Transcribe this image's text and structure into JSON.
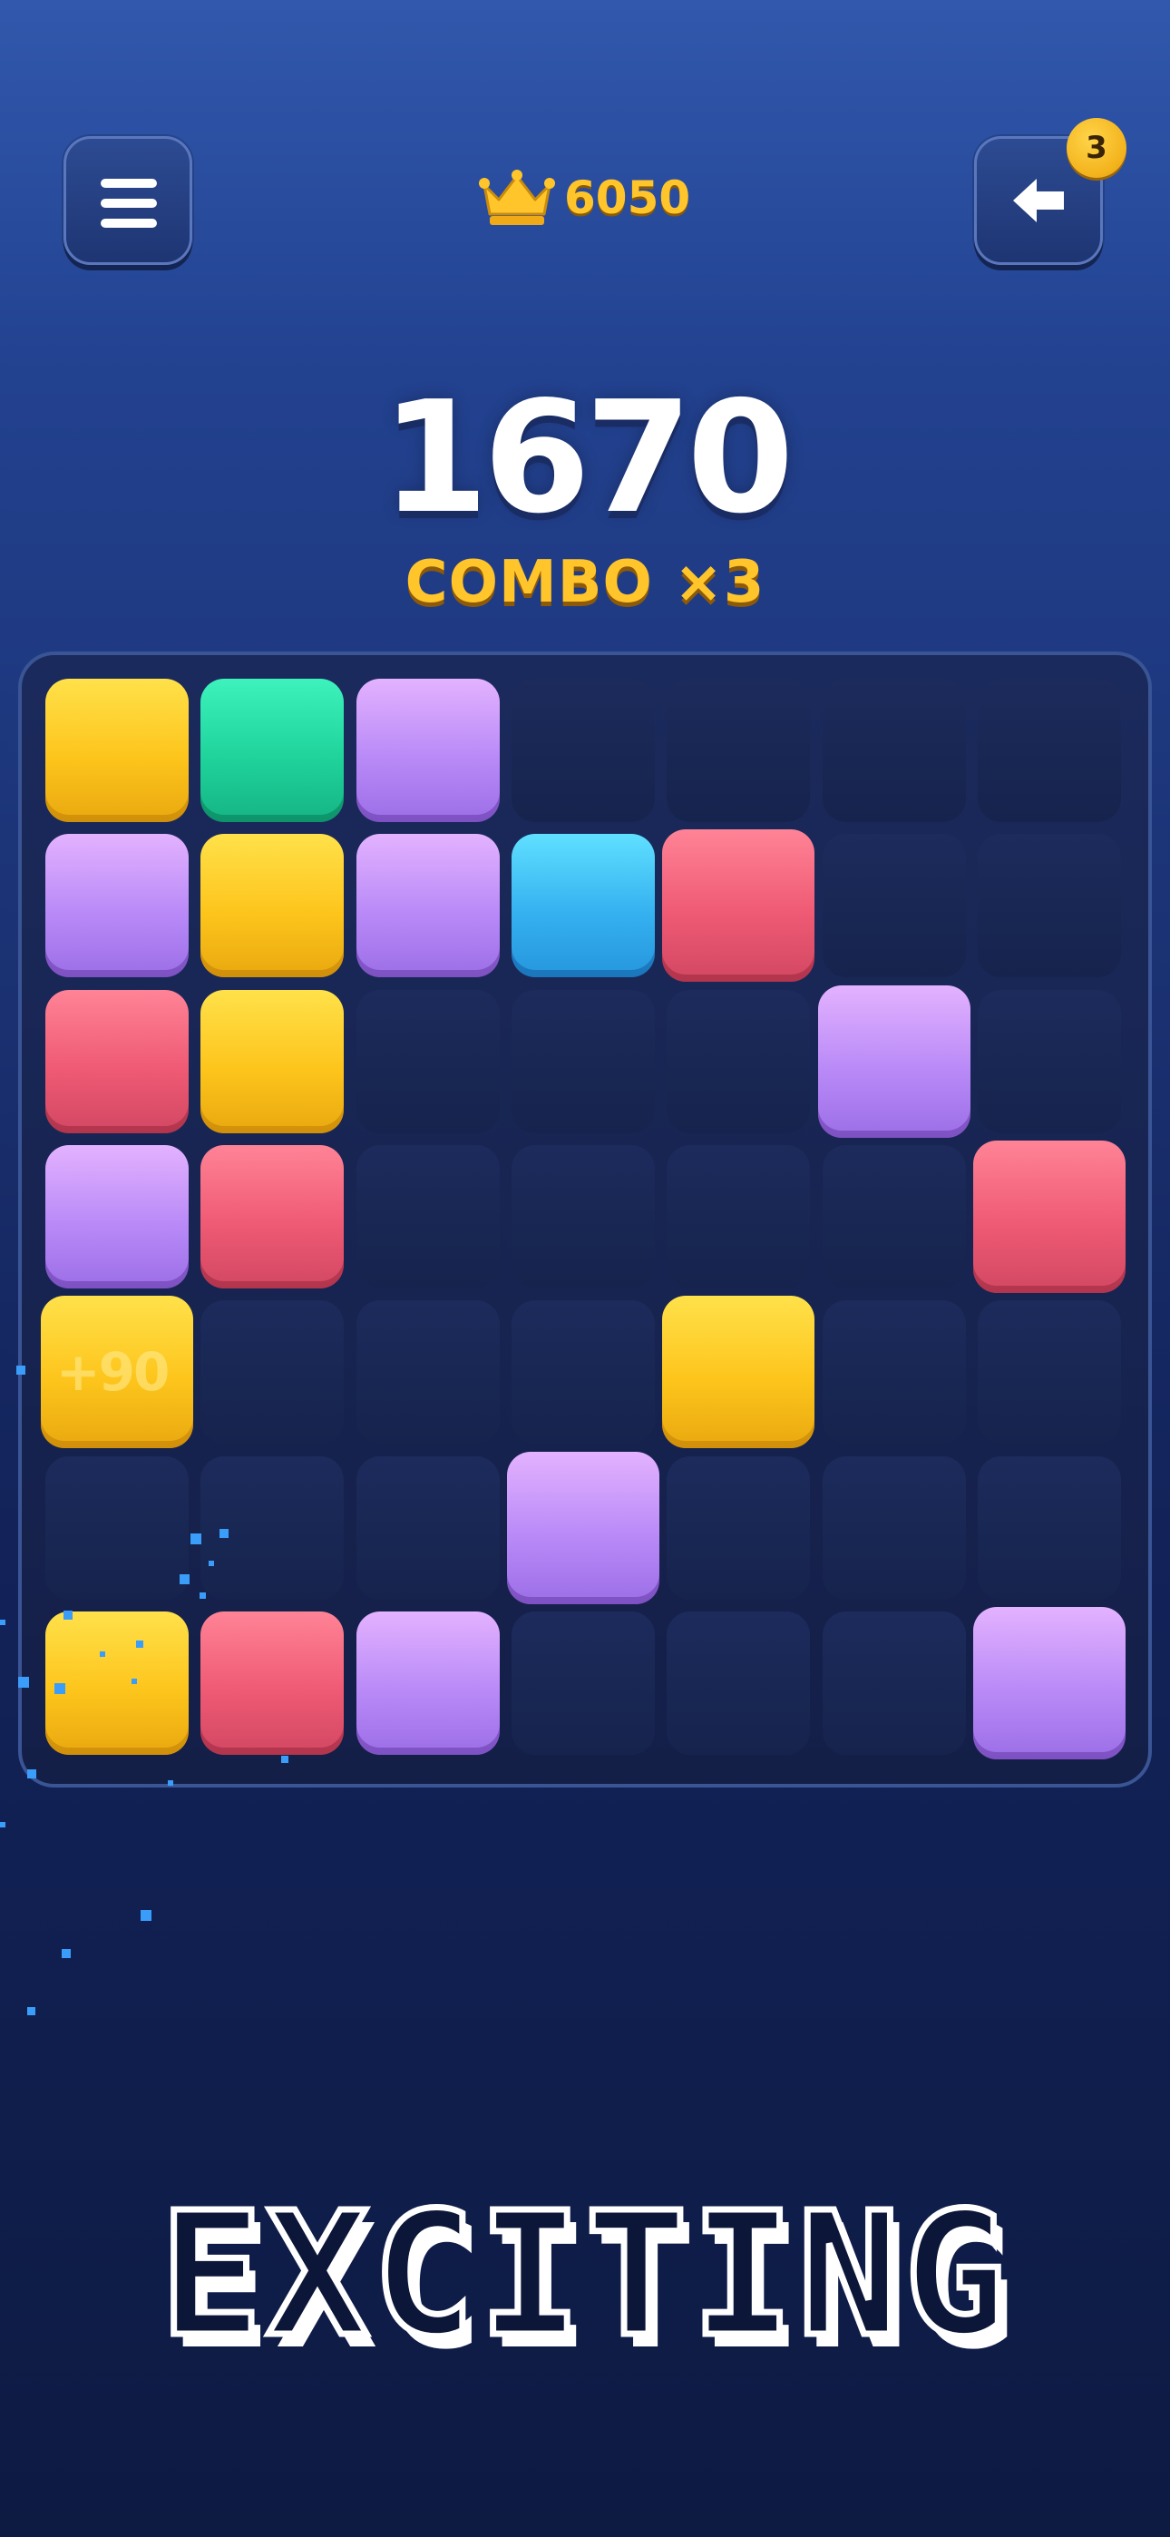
{
  "header": {
    "menu_icon": "hamburger-menu-icon",
    "best_icon": "crown-icon",
    "best_score": "6050",
    "undo_icon": "arrow-left-icon",
    "undo_count": "3"
  },
  "score": {
    "value": "1670",
    "combo": "COMBO ×3"
  },
  "board": {
    "rows": 7,
    "cols": 7,
    "grid": [
      [
        "yellow",
        "green",
        "purple",
        null,
        null,
        null,
        null
      ],
      [
        "purple",
        "yellow",
        "purple",
        "blue",
        "red",
        null,
        null
      ],
      [
        "red",
        "yellow",
        null,
        null,
        null,
        "purple",
        null
      ],
      [
        "purple",
        "red",
        null,
        null,
        null,
        null,
        "red"
      ],
      [
        "yellow",
        null,
        null,
        null,
        "yellow",
        null,
        null
      ],
      [
        null,
        null,
        null,
        "purple",
        null,
        null,
        null
      ],
      [
        "yellow",
        "red",
        "purple",
        null,
        null,
        null,
        "purple"
      ]
    ],
    "points_popup": "+90"
  },
  "colors": {
    "yellow": "#fdc51c",
    "green": "#1fd39b",
    "purple": "#b98af7",
    "blue": "#35b1f0",
    "red": "#ef5a74",
    "accent_gold": "#ffc52a",
    "background": "#1a3070"
  },
  "banner": {
    "text": "EXCITING"
  }
}
